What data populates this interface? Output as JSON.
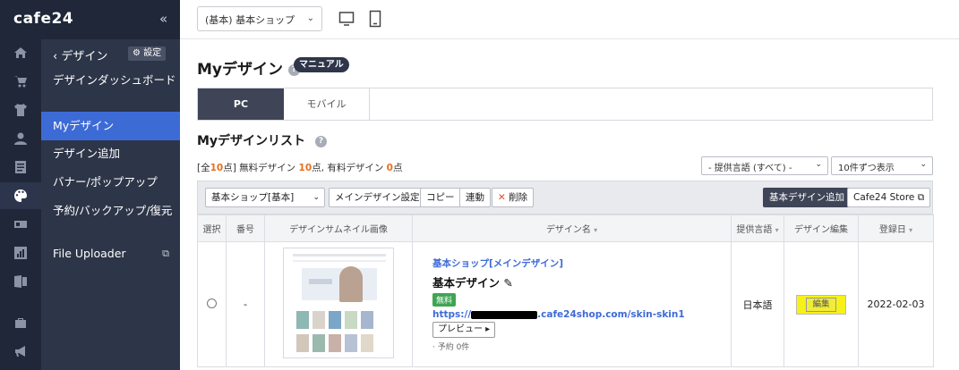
{
  "brand": {
    "logo": "cafe24",
    "collapse": "«"
  },
  "rail": {
    "icons": [
      "home-icon",
      "cart-icon",
      "tshirt-icon",
      "user-icon",
      "board-icon",
      "palette-icon",
      "promo-icon",
      "stats-icon",
      "excel-icon",
      "shop-icon",
      "megaphone-icon"
    ]
  },
  "menu": {
    "back_label": "‹  デザイン",
    "settings_label": "⚙ 設定",
    "items": [
      {
        "label": "デザインダッシュボード"
      },
      {
        "label": "Myデザイン"
      },
      {
        "label": "デザイン追加"
      },
      {
        "label": "バナー/ポップアップ"
      },
      {
        "label": "予約/バックアップ/復元",
        "chevron": "⌄"
      },
      {
        "label": "File Uploader",
        "ext": "⧉"
      }
    ]
  },
  "topbar": {
    "shop_select": "(基本) 基本ショップ",
    "arrow": "⌄"
  },
  "page": {
    "title": "Myデザイン",
    "help": "?",
    "manual_badge": "マニュアル",
    "tabs": {
      "pc": "PC",
      "mobile": "モバイル"
    },
    "section_title": "Myデザインリスト",
    "counts": {
      "prefix": "[全",
      "total": "10",
      "mid1": "点] 無料デザイン ",
      "free": "10",
      "mid2": "点, 有料デザイン ",
      "paid": "0",
      "suffix": "点"
    },
    "filters": {
      "language": "- 提供言語 (すべて) -",
      "per_page": "10件ずつ表示"
    }
  },
  "toolbar": {
    "shop": "基本ショップ[基本]",
    "main_design": "メインデザイン設定",
    "copy": "コピー",
    "link": "連動",
    "delete_x": "✕",
    "delete": " 削除",
    "add_basic": "基本デザイン追加",
    "store": "Cafe24 Store ⧉"
  },
  "table": {
    "headers": [
      "選択",
      "番号",
      "デザインサムネイル画像",
      "デザイン名",
      "提供言語",
      "デザイン編集",
      "登録日"
    ],
    "sort": "▾",
    "row": {
      "number": "-",
      "shop_link": "基本ショップ[メインデザイン]",
      "name": "基本デザイン ✎",
      "badge": "無料",
      "url_prefix": "https://",
      "url_suffix": ".cafe24shop.com/skin-skin1",
      "preview": "プレビュー ▸",
      "reserve": "· 予約 0件",
      "language": "日本語",
      "edit": "編集",
      "date": "2022-02-03"
    }
  }
}
